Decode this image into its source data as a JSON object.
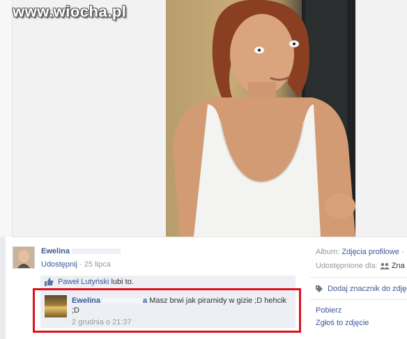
{
  "watermark": "www.wiocha.pl",
  "post": {
    "author": "Ewelina",
    "share_label": "Udostępnij",
    "separator": "·",
    "date": "25 lipca"
  },
  "likes": {
    "name": "Paweł Lutyński",
    "suffix": "lubi to."
  },
  "comment": {
    "author": "Ewelina",
    "author_tail": "a",
    "text": "Masz brwi jak piramidy w gizie ;D hehcik ;D",
    "time": "2 grudnia o 21:37"
  },
  "sidebar": {
    "album_label": "Album:",
    "album_value": "Zdjęcia profilowe",
    "album_sep": "·",
    "shared_label": "Udostępnione dla:",
    "shared_value": "Zna",
    "tag_label": "Dodaj znacznik do zdjęc",
    "download_label": "Pobierz",
    "report_label": "Zgłoś to zdjęcie"
  },
  "colors": {
    "link": "#3b5998",
    "highlight_frame": "#e0101a",
    "comment_bg": "#edeff4"
  },
  "icons": {
    "like": "thumbs-up-icon",
    "audience": "friends-icon",
    "tag": "tag-icon"
  }
}
